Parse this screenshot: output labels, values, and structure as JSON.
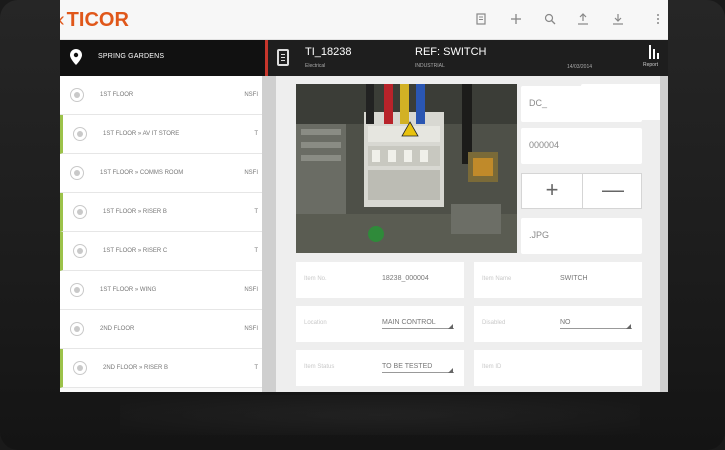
{
  "app": {
    "logo_chevron": "‹",
    "logo": "TICOR"
  },
  "toolbar": {
    "icons": [
      "clipboard-icon",
      "plus-icon",
      "search-icon",
      "upload-icon",
      "download-icon",
      "more-icon"
    ]
  },
  "sidebar": {
    "title": "SPRING GARDENS",
    "items": [
      {
        "label": "1ST FLOOR",
        "tag": "NSFI"
      },
      {
        "label": "1ST FLOOR » AV IT STORE",
        "tag": "T"
      },
      {
        "label": "1ST FLOOR » COMMS ROOM",
        "tag": "NSFI"
      },
      {
        "label": "1ST FLOOR » RISER B",
        "tag": "T"
      },
      {
        "label": "1ST FLOOR » RISER C",
        "tag": "T"
      },
      {
        "label": "1ST FLOOR » WING",
        "tag": "NSFI"
      },
      {
        "label": "2ND FLOOR",
        "tag": "NSFI"
      },
      {
        "label": "2ND FLOOR » RISER B",
        "tag": "T"
      }
    ]
  },
  "header": {
    "id": "TI_18238",
    "id_sub": "Electrical",
    "ref": "REF: SWITCH",
    "ref_sub": "INDUSTRIAL",
    "date": "14/03/2014",
    "report_label": "Report"
  },
  "detail": {
    "field_dc": "DC_",
    "field_number": "000004",
    "field_ext": ".JPG",
    "stepper_plus": "+",
    "stepper_minus": "—",
    "item_no_label": "Item No.",
    "item_no_value": "18238_000004",
    "item_name_label": "Item Name",
    "item_name_value": "SWITCH",
    "location_label": "Location",
    "location_value": "MAIN CONTROL",
    "disabled_label": "Disabled",
    "disabled_value": "NO",
    "item_status_label": "Item Status",
    "item_status_value": "TO BE TESTED",
    "item_id_label": "Item ID"
  },
  "colors": {
    "brand": "#e0571a",
    "accent": "#9cc24a",
    "header": "#111111",
    "alert": "#c7362c"
  }
}
